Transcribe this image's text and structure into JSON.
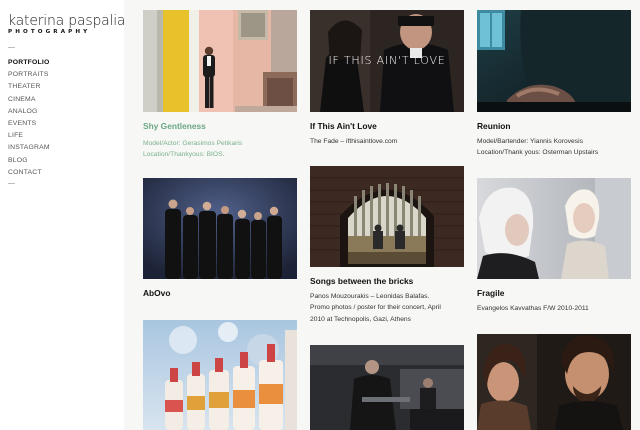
{
  "logo": {
    "name": "katerina paspaliari",
    "sub": "PHOTOGRAPHY"
  },
  "nav": [
    "PORTFOLIO",
    "PORTRAITS",
    "THEATER",
    "CINEMA",
    "ANALOG",
    "EVENTS",
    "LIFE",
    "INSTAGRAM",
    "BLOG",
    "CONTACT"
  ],
  "cards": {
    "shy": {
      "title": "Shy Gentleness",
      "lines": [
        "Model/Actor: Gerasimos Petikaris",
        "Location/Thankyous: BIOS."
      ]
    },
    "ifthis": {
      "title": "If This Ain't Love",
      "overlay": "IF THIS AIN'T LOVE",
      "lines": [
        "The Fade – ifthisaintlove.com"
      ]
    },
    "reunion": {
      "title": "Reunion",
      "lines": [
        "Model/Bartender: Yiannis Korovesis",
        "Location/Thank yous: Osterman Upstairs"
      ]
    },
    "abovo": {
      "title": "AbOvo",
      "lines": []
    },
    "songs": {
      "title": "Songs between the bricks",
      "lines": [
        "Panos Mouzourakis – Leonidas Balafas.",
        "Promo photos / poster for their concert, April",
        "2010 at Technopolis, Gazi, Athens"
      ]
    },
    "fragile": {
      "title": "Fragile",
      "lines": [
        "Evangelos Kavvathas F/W 2010-2011"
      ]
    }
  }
}
